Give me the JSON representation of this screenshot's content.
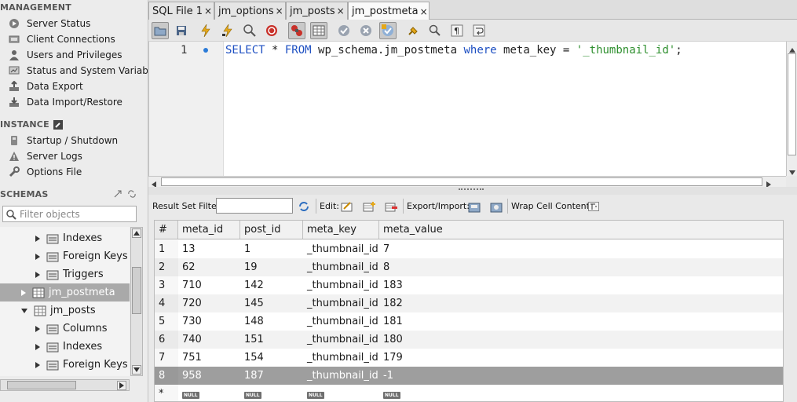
{
  "sidebar": {
    "management": {
      "heading": "MANAGEMENT",
      "items": [
        {
          "label": "Server Status",
          "icon": "server-status-icon"
        },
        {
          "label": "Client Connections",
          "icon": "connections-icon"
        },
        {
          "label": "Users and Privileges",
          "icon": "user-icon"
        },
        {
          "label": "Status and System Variab",
          "icon": "variables-icon"
        },
        {
          "label": "Data Export",
          "icon": "export-icon"
        },
        {
          "label": "Data Import/Restore",
          "icon": "import-icon"
        }
      ]
    },
    "instance": {
      "heading": "INSTANCE",
      "items": [
        {
          "label": "Startup / Shutdown",
          "icon": "startup-icon"
        },
        {
          "label": "Server Logs",
          "icon": "warning-icon"
        },
        {
          "label": "Options File",
          "icon": "wrench-icon"
        }
      ]
    },
    "schemas": {
      "heading": "SCHEMAS",
      "filter_placeholder": "Filter objects",
      "tree": [
        {
          "label": "Indexes",
          "depth": 2,
          "expanded": false,
          "selected": false
        },
        {
          "label": "Foreign Keys",
          "depth": 2,
          "expanded": false,
          "selected": false
        },
        {
          "label": "Triggers",
          "depth": 2,
          "expanded": false,
          "selected": false
        },
        {
          "label": "jm_postmeta",
          "depth": 1,
          "expanded": false,
          "selected": true
        },
        {
          "label": "jm_posts",
          "depth": 1,
          "expanded": true,
          "selected": false
        },
        {
          "label": "Columns",
          "depth": 2,
          "expanded": false,
          "selected": false
        },
        {
          "label": "Indexes",
          "depth": 2,
          "expanded": false,
          "selected": false
        },
        {
          "label": "Foreign Keys",
          "depth": 2,
          "expanded": false,
          "selected": false
        }
      ]
    }
  },
  "tabs": [
    {
      "label": "SQL File 1",
      "active": false
    },
    {
      "label": "jm_options",
      "active": false
    },
    {
      "label": "jm_posts",
      "active": false
    },
    {
      "label": "jm_postmeta",
      "active": true
    }
  ],
  "tab_close_glyph": "×",
  "editor": {
    "line_number": "1",
    "query_parts": [
      {
        "t": "SELECT",
        "c": "kw"
      },
      {
        "t": " * ",
        "c": ""
      },
      {
        "t": "FROM",
        "c": "kw"
      },
      {
        "t": " wp_schema.jm_postmeta ",
        "c": ""
      },
      {
        "t": "where",
        "c": "kw"
      },
      {
        "t": " meta_key = ",
        "c": ""
      },
      {
        "t": "'_thumbnail_id'",
        "c": "str"
      },
      {
        "t": ";",
        "c": ""
      }
    ]
  },
  "result_toolbar": {
    "filter_label": "Result Set Filter:",
    "filter_value": "",
    "edit_label": "Edit:",
    "export_label": "Export/Import:",
    "wrap_label": "Wrap Cell Content:"
  },
  "grid": {
    "columns": [
      "#",
      "meta_id",
      "post_id",
      "meta_key",
      "meta_value"
    ],
    "rows": [
      [
        "1",
        "13",
        "1",
        "_thumbnail_id",
        "7"
      ],
      [
        "2",
        "62",
        "19",
        "_thumbnail_id",
        "8"
      ],
      [
        "3",
        "710",
        "142",
        "_thumbnail_id",
        "183"
      ],
      [
        "4",
        "720",
        "145",
        "_thumbnail_id",
        "182"
      ],
      [
        "5",
        "730",
        "148",
        "_thumbnail_id",
        "181"
      ],
      [
        "6",
        "740",
        "151",
        "_thumbnail_id",
        "180"
      ],
      [
        "7",
        "751",
        "154",
        "_thumbnail_id",
        "179"
      ],
      [
        "8",
        "958",
        "187",
        "_thumbnail_id",
        "-1"
      ]
    ],
    "selected_row": 7,
    "new_row_marker": "*",
    "null_text": "NULL"
  }
}
